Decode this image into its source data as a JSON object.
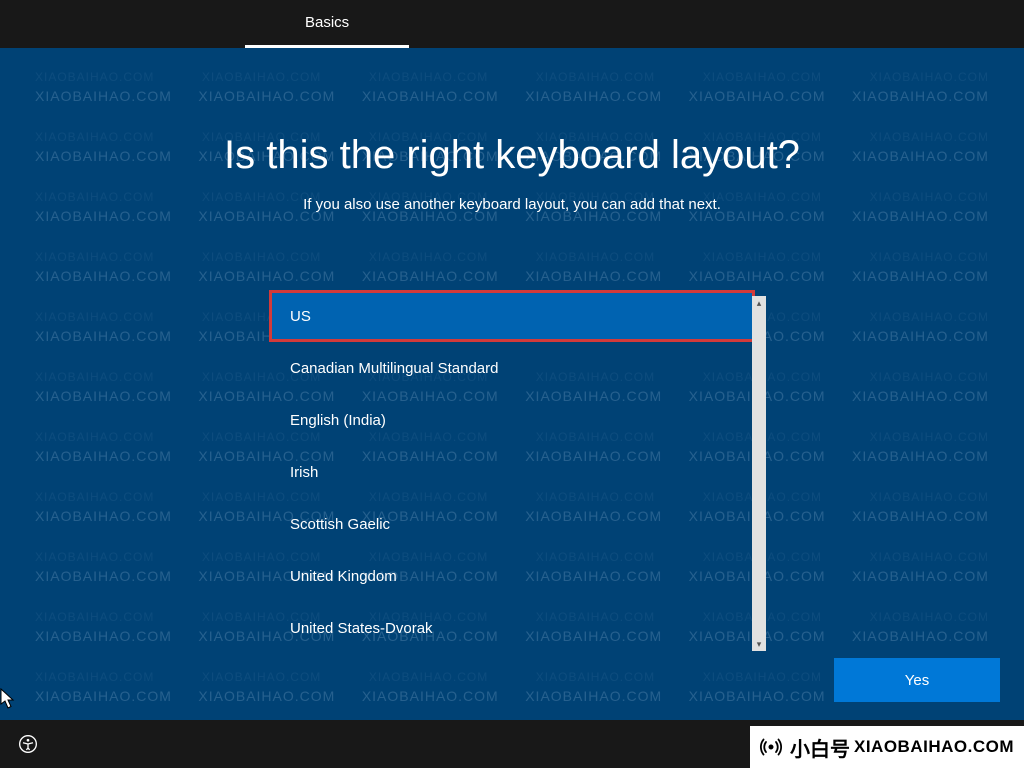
{
  "watermark_text": "XIAOBAIHAO.COM",
  "topbar": {
    "tabs": [
      {
        "label": "Basics",
        "active": true
      }
    ]
  },
  "main": {
    "heading": "Is this the right keyboard layout?",
    "subtitle": "If you also use another keyboard layout, you can add that next.",
    "layouts": [
      "US",
      "Canadian Multilingual Standard",
      "English (India)",
      "Irish",
      "Scottish Gaelic",
      "United Kingdom",
      "United States-Dvorak"
    ],
    "selected_index": 0,
    "yes_button": "Yes"
  },
  "bottombar": {
    "ease_icon": "ease-of-access-icon"
  },
  "corner_badge": {
    "cn": "小白号",
    "domain": "XIAOBAIHAO.COM"
  }
}
